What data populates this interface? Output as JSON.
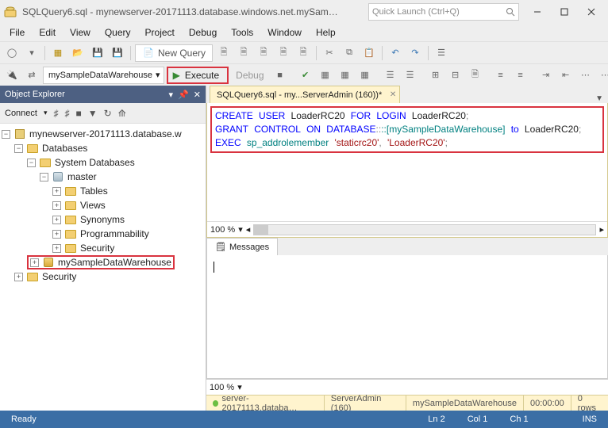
{
  "title": "SQLQuery6.sql - mynewserver-20171113.database.windows.net.mySampleDa...",
  "quicklaunch_placeholder": "Quick Launch (Ctrl+Q)",
  "menu": [
    "File",
    "Edit",
    "View",
    "Query",
    "Project",
    "Debug",
    "Tools",
    "Window",
    "Help"
  ],
  "toolbar1": {
    "newquery": "New Query"
  },
  "toolbar2": {
    "db_dropdown": "mySampleDataWarehouse",
    "execute": "Execute",
    "debug": "Debug"
  },
  "explorer": {
    "title": "Object Explorer",
    "connect": "Connect",
    "tree": {
      "server": "mynewserver-20171113.database.w",
      "databases": "Databases",
      "sysdb": "System Databases",
      "master": "master",
      "tables": "Tables",
      "views": "Views",
      "synonyms": "Synonyms",
      "programmability": "Programmability",
      "security_inner": "Security",
      "userdb": "mySampleDataWarehouse",
      "security_outer": "Security"
    }
  },
  "editor": {
    "tab": "SQLQuery6.sql - my...ServerAdmin (160))*",
    "code": {
      "l1a": "CREATE",
      "l1b": "USER",
      "l1c": "LoaderRC20",
      "l1d": "FOR",
      "l1e": "LOGIN",
      "l1f": "LoaderRC20",
      "l2a": "GRANT",
      "l2b": "CONTROL",
      "l2c": "ON",
      "l2d": "DATABASE",
      "l2e": "::[mySampleDataWarehouse]",
      "l2f": "to",
      "l2g": "LoaderRC20",
      "l3a": "EXEC",
      "l3b": "sp_addrolemember",
      "l3c": "'staticrc20'",
      "l3d": "'LoaderRC20'"
    },
    "zoom": "100 %",
    "messages_tab": "Messages",
    "conn": {
      "server": "server-20171113.databa…",
      "user": "ServerAdmin (160)",
      "db": "mySampleDataWarehouse",
      "time": "00:00:00",
      "rows": "0 rows"
    }
  },
  "status": {
    "ready": "Ready",
    "ln": "Ln 2",
    "col": "Col 1",
    "ch": "Ch 1",
    "ins": "INS"
  }
}
